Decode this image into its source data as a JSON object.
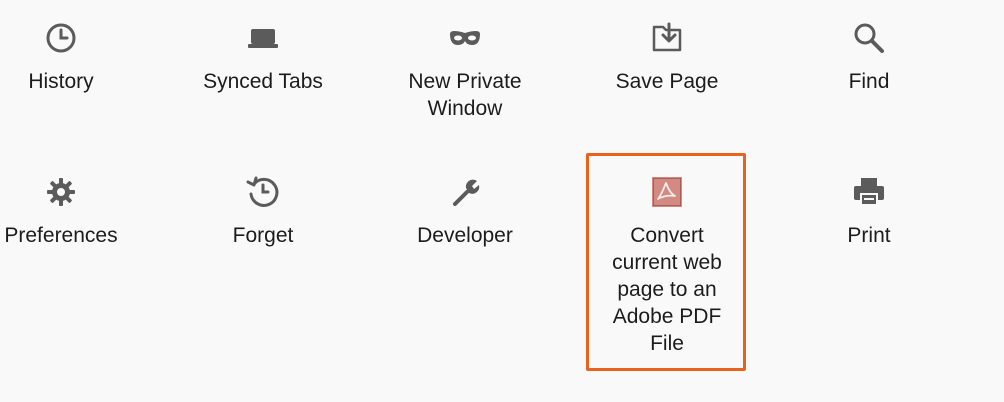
{
  "menu": {
    "items": [
      {
        "id": "history",
        "label": "History",
        "icon": "clock-icon"
      },
      {
        "id": "synced-tabs",
        "label": "Synced Tabs",
        "icon": "synced-tabs-icon"
      },
      {
        "id": "new-private-window",
        "label": "New Private Window",
        "icon": "mask-icon"
      },
      {
        "id": "save-page",
        "label": "Save Page",
        "icon": "save-page-icon"
      },
      {
        "id": "find",
        "label": "Find",
        "icon": "search-icon"
      },
      {
        "id": "preferences",
        "label": "Preferences",
        "icon": "gear-icon"
      },
      {
        "id": "forget",
        "label": "Forget",
        "icon": "forget-icon"
      },
      {
        "id": "developer",
        "label": "Developer",
        "icon": "wrench-icon"
      },
      {
        "id": "convert-pdf",
        "label": "Convert current web page to an Adobe PDF File",
        "icon": "adobe-pdf-icon"
      },
      {
        "id": "print",
        "label": "Print",
        "icon": "printer-icon"
      }
    ]
  },
  "colors": {
    "icon": "#5b5b5b",
    "text": "#1c1c1c",
    "background": "#f9f9f9",
    "highlight_border": "#e8641e",
    "pdf_icon_bg": "#d28a82"
  }
}
